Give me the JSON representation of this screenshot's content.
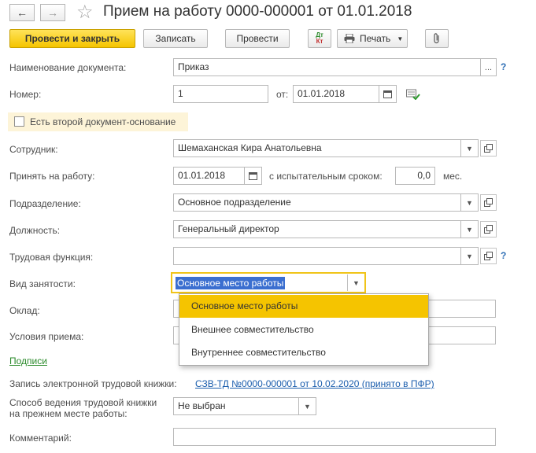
{
  "header": {
    "title": "Прием на работу 0000-000001 от 01.01.2018",
    "back_glyph": "←",
    "forward_glyph": "→",
    "star_glyph": "☆"
  },
  "toolbar": {
    "post_close_label": "Провести и закрыть",
    "save_label": "Записать",
    "post_label": "Провести",
    "dtkt_top": "Дт",
    "dtkt_bottom": "Кт",
    "print_label": "Печать"
  },
  "form": {
    "doc_name_label": "Наименование документа:",
    "doc_name_value": "Приказ",
    "number_label": "Номер:",
    "number_value": "1",
    "date_label": "от:",
    "date_value": "01.01.2018",
    "second_basis_label": "Есть второй документ-основание",
    "employee_label": "Сотрудник:",
    "employee_value": "Шемаханская Кира Анатольевна",
    "hire_date_label": "Принять на работу:",
    "hire_date_value": "01.01.2018",
    "probation_label": "с испытательным сроком:",
    "probation_value": "0,0",
    "probation_unit": "мес.",
    "department_label": "Подразделение:",
    "department_value": "Основное подразделение",
    "position_label": "Должность:",
    "position_value": "Генеральный директор",
    "labor_function_label": "Трудовая функция:",
    "labor_function_value": "",
    "employment_type_label": "Вид занятости:",
    "employment_type_value": "Основное место работы",
    "salary_label": "Оклад:",
    "conditions_label": "Условия приема:",
    "signatures_link": "Подписи",
    "electronic_record_label": "Запись электронной трудовой книжки:",
    "electronic_record_link": "СЗВ-ТД №0000-000001 от 10.02.2020 (принято в ПФР)",
    "prev_method_label_line1": "Способ ведения трудовой книжки",
    "prev_method_label_line2": "на прежнем месте работы:",
    "prev_method_value": "Не выбран",
    "comment_label": "Комментарий:",
    "comment_value": "",
    "help_glyph": "?"
  },
  "dropdown": {
    "options": [
      "Основное место работы",
      "Внешнее совместительство",
      "Внутреннее совместительство"
    ],
    "selected_index": 0
  },
  "colors": {
    "accent_yellow": "#f5c400",
    "link_blue": "#1a5dad",
    "selection_blue": "#3b6fd0",
    "help_blue": "#2f6fb5"
  }
}
